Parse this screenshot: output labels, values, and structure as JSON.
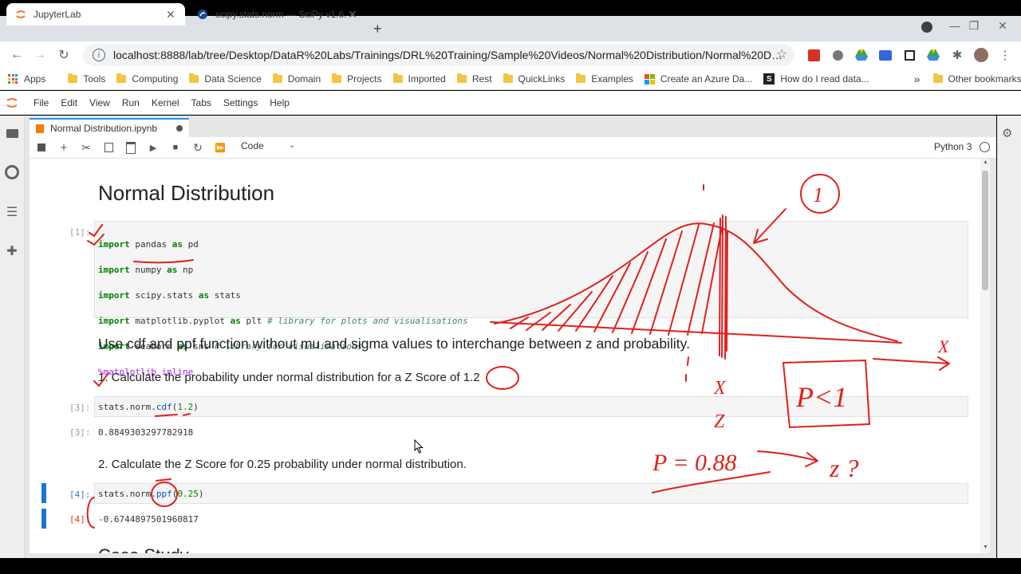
{
  "browser": {
    "tabs": [
      {
        "title": "JupyterLab",
        "active": true
      },
      {
        "title": "scipy.stats.norm — SciPy v1.6.3 R",
        "active": false
      }
    ],
    "url": "localhost:8888/lab/tree/Desktop/DataR%20Labs/Trainings/DRL%20Training/Sample%20Videos/Normal%20Distribution/Normal%20Distributi...",
    "bookmarks": [
      "Apps",
      "Tools",
      "Computing",
      "Data Science",
      "Domain",
      "Projects",
      "Imported",
      "Rest",
      "QuickLinks",
      "Examples",
      "Create an Azure Da...",
      "How do I read data..."
    ],
    "other_bookmarks": "Other bookmarks",
    "more": "»"
  },
  "jupyter": {
    "menu": [
      "File",
      "Edit",
      "View",
      "Run",
      "Kernel",
      "Tabs",
      "Settings",
      "Help"
    ],
    "notebook_tab": "Normal Distribution.ipynb",
    "cell_type": "Code",
    "kernel": "Python 3"
  },
  "notebook": {
    "title": "Normal Distribution",
    "cell1_prompt": "[1]:",
    "cell1_lines": [
      {
        "kw": "import",
        "mod": " pandas ",
        "as": "as",
        "alias": " pd",
        "comment": ""
      },
      {
        "kw": "import",
        "mod": " numpy ",
        "as": "as",
        "alias": " np",
        "comment": ""
      },
      {
        "kw": "import",
        "mod": " scipy.stats ",
        "as": "as",
        "alias": " stats",
        "comment": ""
      },
      {
        "kw": "import",
        "mod": " matplotlib.pyplot ",
        "as": "as",
        "alias": " plt ",
        "comment": "# library for plots and visualisations"
      },
      {
        "kw": "import",
        "mod": " seaborn ",
        "as": "as",
        "alias": " sns ",
        "comment": "# library for visualisations"
      }
    ],
    "cell1_magic": "%matplotlib inline",
    "md1": "Use cdf and ppf function without mu and sigma values to interchange between z and probability.",
    "md2": "1. Calculate the probability under normal distribution for a Z Score of 1.2",
    "cell3_prompt": "[3]:",
    "cell3_code_prefix": "stats.norm.",
    "cell3_code_fn": "cdf",
    "cell3_code_arg": "1.2",
    "cell3_out_prompt": "[3]:",
    "cell3_out": "0.8849303297782918",
    "md3": "2. Calculate the Z Score for 0.25 probability under normal distribution.",
    "cell4_prompt": "[4]:",
    "cell4_code_prefix": "stats.norm.",
    "cell4_code_fn": "ppf",
    "cell4_code_arg": "0.25",
    "cell4_out_prompt": "[4]:",
    "cell4_out": "-0.6744897501960817",
    "next_heading": "Case Study"
  },
  "annotations": {
    "circle_one": "1",
    "x_axis": "X",
    "x_label": "X",
    "z_label": "Z",
    "p_lt_1": "P<1",
    "p_eq": "P = 0.88",
    "z_q": "z ?"
  },
  "colors": {
    "ink": "#e0201c",
    "accent": "#2196f3"
  }
}
